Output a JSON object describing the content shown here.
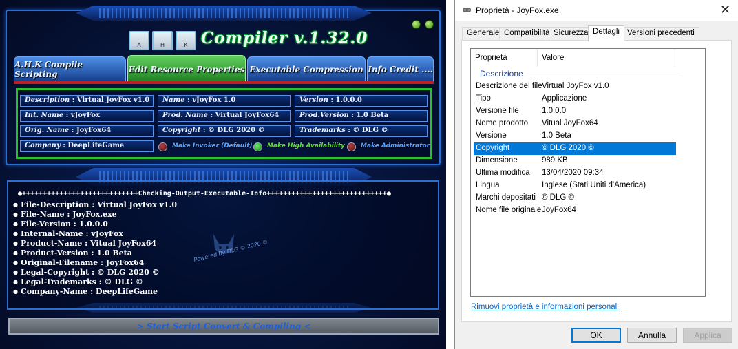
{
  "compiler": {
    "title": "Compiler v.1.32.0",
    "keys": [
      "A",
      "H",
      "K"
    ],
    "tabs": [
      {
        "label": "A.H.K Compile Scripting"
      },
      {
        "label": "Edit Resource Properties"
      },
      {
        "label": "Executable Compression"
      },
      {
        "label": "Info Credit ...."
      }
    ],
    "fields": {
      "description": {
        "label": "Description",
        "value": "Virtual JoyFox v1.0"
      },
      "name": {
        "label": "Name",
        "value": "vJoyFox 1.0"
      },
      "version": {
        "label": "Version",
        "value": "1.0.0.0"
      },
      "int_name": {
        "label": "Int. Name",
        "value": "vJoyFox"
      },
      "prod_name": {
        "label": "Prod. Name",
        "value": "Virtual JoyFox64"
      },
      "prod_version": {
        "label": "Prod.Version",
        "value": "1.0 Beta"
      },
      "orig_name": {
        "label": "Orig. Name",
        "value": "JoyFox64"
      },
      "copyright": {
        "label": "Copyright",
        "value": "© DLG 2020 ©"
      },
      "trademarks": {
        "label": "Trademarks",
        "value": "© DLG ©"
      },
      "company": {
        "label": "Company",
        "value": "DeepLifeGame"
      }
    },
    "radios": [
      {
        "label": "Make Invoker (Default)",
        "color": "#5aa0ff"
      },
      {
        "label": "Make High Availability",
        "color": "#5be03a"
      },
      {
        "label": "Make Administrator",
        "color": "#5aa0ff"
      }
    ],
    "output_header": "●++++++++++++++++++++++++++++Checking-Output-Executable-Info+++++++++++++++++++++++++++++●",
    "output_lines": [
      "File-Description : Virtual JoyFox v1.0",
      "File-Name : JoyFox.exe",
      "File-Version : 1.0.0.0",
      "Internal-Name : vJoyFox",
      "Product-Name : Vitual JoyFox64",
      "Product-Version : 1.0 Beta",
      "Original-Filename : JoyFox64",
      "Legal-Copyright : © DLG 2020 ©",
      "Legal-Trademarks : © DLG ©",
      "Company-Name : DeepLifeGame"
    ],
    "watermark": "Powered By DLG © 2020 ©",
    "start_button": "> Start Script Convert & Compiling <"
  },
  "properties": {
    "window_title": "Proprietà - JoyFox.exe",
    "tabs": [
      "Generale",
      "Compatibilità",
      "Sicurezza",
      "Dettagli",
      "Versioni precedenti"
    ],
    "active_tab": "Dettagli",
    "columns": [
      "Proprietà",
      "Valore"
    ],
    "group": "Descrizione",
    "rows": [
      {
        "key": "Descrizione del file",
        "value": "Virtual JoyFox v1.0"
      },
      {
        "key": "Tipo",
        "value": "Applicazione"
      },
      {
        "key": "Versione file",
        "value": "1.0.0.0"
      },
      {
        "key": "Nome prodotto",
        "value": "Vitual JoyFox64"
      },
      {
        "key": "Versione",
        "value": "1.0 Beta"
      },
      {
        "key": "Copyright",
        "value": "© DLG 2020 ©"
      },
      {
        "key": "Dimensione",
        "value": "989 KB"
      },
      {
        "key": "Ultima modifica",
        "value": "13/04/2020 09:34"
      },
      {
        "key": "Lingua",
        "value": "Inglese (Stati Uniti d'America)"
      },
      {
        "key": "Marchi depositati",
        "value": "© DLG ©"
      },
      {
        "key": "Nome file originale",
        "value": "JoyFox64"
      }
    ],
    "selected_row": "Copyright",
    "remove_link": "Rimuovi proprietà e informazioni personali",
    "buttons": {
      "ok": "OK",
      "cancel": "Annulla",
      "apply": "Applica"
    }
  }
}
